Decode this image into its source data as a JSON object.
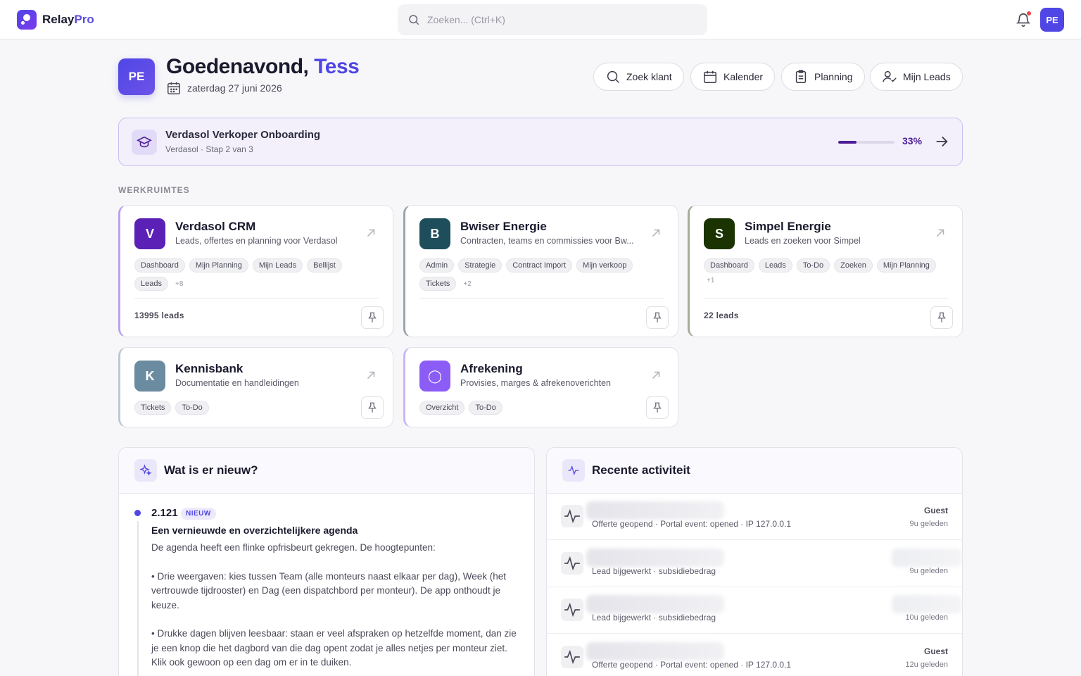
{
  "app": {
    "name": "Relay",
    "name_suffix": "Pro"
  },
  "search": {
    "placeholder": "Zoeken... (Ctrl+K)"
  },
  "user": {
    "initials": "PE"
  },
  "header": {
    "greeting": "Goedenavond, ",
    "name": "Tess",
    "date": "zaterdag 27 juni 2026"
  },
  "quick_actions": [
    {
      "label": "Zoek klant",
      "icon": "search-user-icon"
    },
    {
      "label": "Kalender",
      "icon": "calendar-icon"
    },
    {
      "label": "Planning",
      "icon": "clipboard-icon"
    },
    {
      "label": "Mijn Leads",
      "icon": "user-check-icon"
    }
  ],
  "onboarding": {
    "title": "Verdasol Verkoper Onboarding",
    "subtitle": "Verdasol · Stap 2 van 3",
    "progress": 0.33,
    "progress_label": "33%",
    "icon": "graduation-cap-icon",
    "accent": "#4c1d95"
  },
  "section_label": "WERKRUIMTES",
  "workspaces": [
    {
      "letter": "V",
      "color": "#5b21b6",
      "border": "#b8a4ec",
      "title": "Verdasol CRM",
      "desc": "Leads, offertes en planning voor Verdasol",
      "tags": [
        "Dashboard",
        "Mijn Planning",
        "Mijn Leads",
        "Bellijst",
        "Leads"
      ],
      "more": "+8",
      "count": "13995 leads"
    },
    {
      "letter": "B",
      "color": "#1e4d5c",
      "border": "#9aa4b0",
      "title": "Bwiser Energie",
      "desc": "Contracten, teams en commissies voor Bw...",
      "tags": [
        "Admin",
        "Strategie",
        "Contract Import",
        "Mijn verkoop",
        "Tickets"
      ],
      "more": "+2",
      "count": ""
    },
    {
      "letter": "S",
      "color": "#1a3300",
      "border": "#a3ac95",
      "title": "Simpel Energie",
      "desc": "Leads en zoeken voor Simpel",
      "tags": [
        "Dashboard",
        "Leads",
        "To-Do",
        "Zoeken",
        "Mijn Planning"
      ],
      "more": "+1",
      "count": "22 leads"
    },
    {
      "letter": "K",
      "color": "#6b8ba0",
      "border": "#bccad4",
      "title": "Kennisbank",
      "desc": "Documentatie en handleidingen",
      "tags": [
        "Tickets",
        "To-Do"
      ],
      "more": "",
      "count": ""
    },
    {
      "letter": "◯",
      "color": "#8b5cf6",
      "border": "#c9b6f7",
      "title": "Afrekening",
      "desc": "Provisies, marges & afrekenoverichten",
      "tags": [
        "Overzicht",
        "To-Do"
      ],
      "more": "",
      "count": ""
    }
  ],
  "news": {
    "title": "Wat is er nieuw?",
    "version": "2.121",
    "badge": "NIEUW",
    "headline": "Een vernieuwde en overzichtelijkere agenda",
    "paragraphs": [
      "De agenda heeft een flinke opfrisbeurt gekregen. De hoogtepunten:",
      "• Drie weergaven: kies tussen Team (alle monteurs naast elkaar per dag), Week (het vertrouwde tijdrooster) en Dag (een dispatchbord per monteur). De app onthoudt je keuze.",
      "• Drukke dagen blijven leesbaar: staan er veel afspraken op hetzelfde moment, dan zie je een knop die het dagbord van die dag opent zodat je alles netjes per monteur ziet. Klik ook gewoon op een dag om er in te duiken."
    ]
  },
  "activity": {
    "title": "Recente activiteit",
    "items": [
      {
        "subtitle": "Offerte geopend · Portal event: opened · IP 127.0.0.1",
        "who": "Guest",
        "time": "9u geleden"
      },
      {
        "subtitle": "Lead bijgewerkt · subsidiebedrag",
        "who": "",
        "time": "9u geleden"
      },
      {
        "subtitle": "Lead bijgewerkt · subsidiebedrag",
        "who": "",
        "time": "10u geleden"
      },
      {
        "subtitle": "Offerte geopend · Portal event: opened · IP 127.0.0.1",
        "who": "Guest",
        "time": "12u geleden"
      }
    ]
  }
}
